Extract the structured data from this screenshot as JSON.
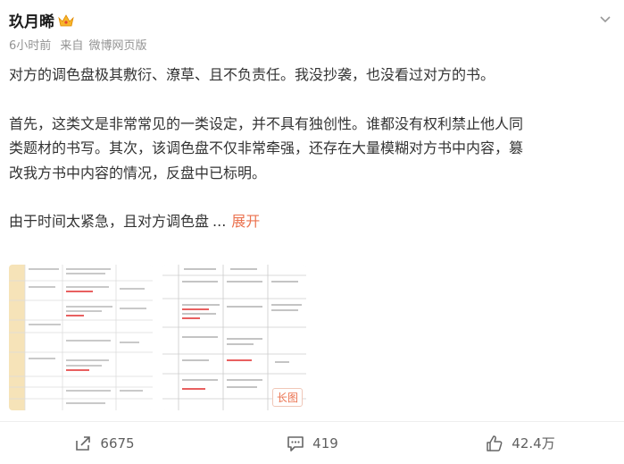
{
  "user": {
    "name": "玖月晞"
  },
  "meta": {
    "time": "6小时前",
    "source_prefix": "来自",
    "source": "微博网页版"
  },
  "post": {
    "para1": "对方的调色盘极其敷衍、潦草、且不负责任。我没抄袭，也没看过对方的书。",
    "para2_line1": "首先，这类文是非常常见的一类设定，并不具有独创性。谁都没有权利禁止他人同",
    "para2_line2": "类题材的书写。其次，该调色盘不仅非常牵强，还存在大量模糊对方书中内容，篡",
    "para2_line3": "改我方书中内容的情况，反盘中已标明。",
    "para3": "由于时间太紧急，且对方调色盘",
    "ellipsis": "...",
    "expand": "展开"
  },
  "images": {
    "badge": "长图"
  },
  "footer": {
    "share_count": "6675",
    "comment_count": "419",
    "like_count": "42.4万"
  },
  "colors": {
    "accent": "#eb7350",
    "muted": "#939393",
    "text": "#333333"
  }
}
